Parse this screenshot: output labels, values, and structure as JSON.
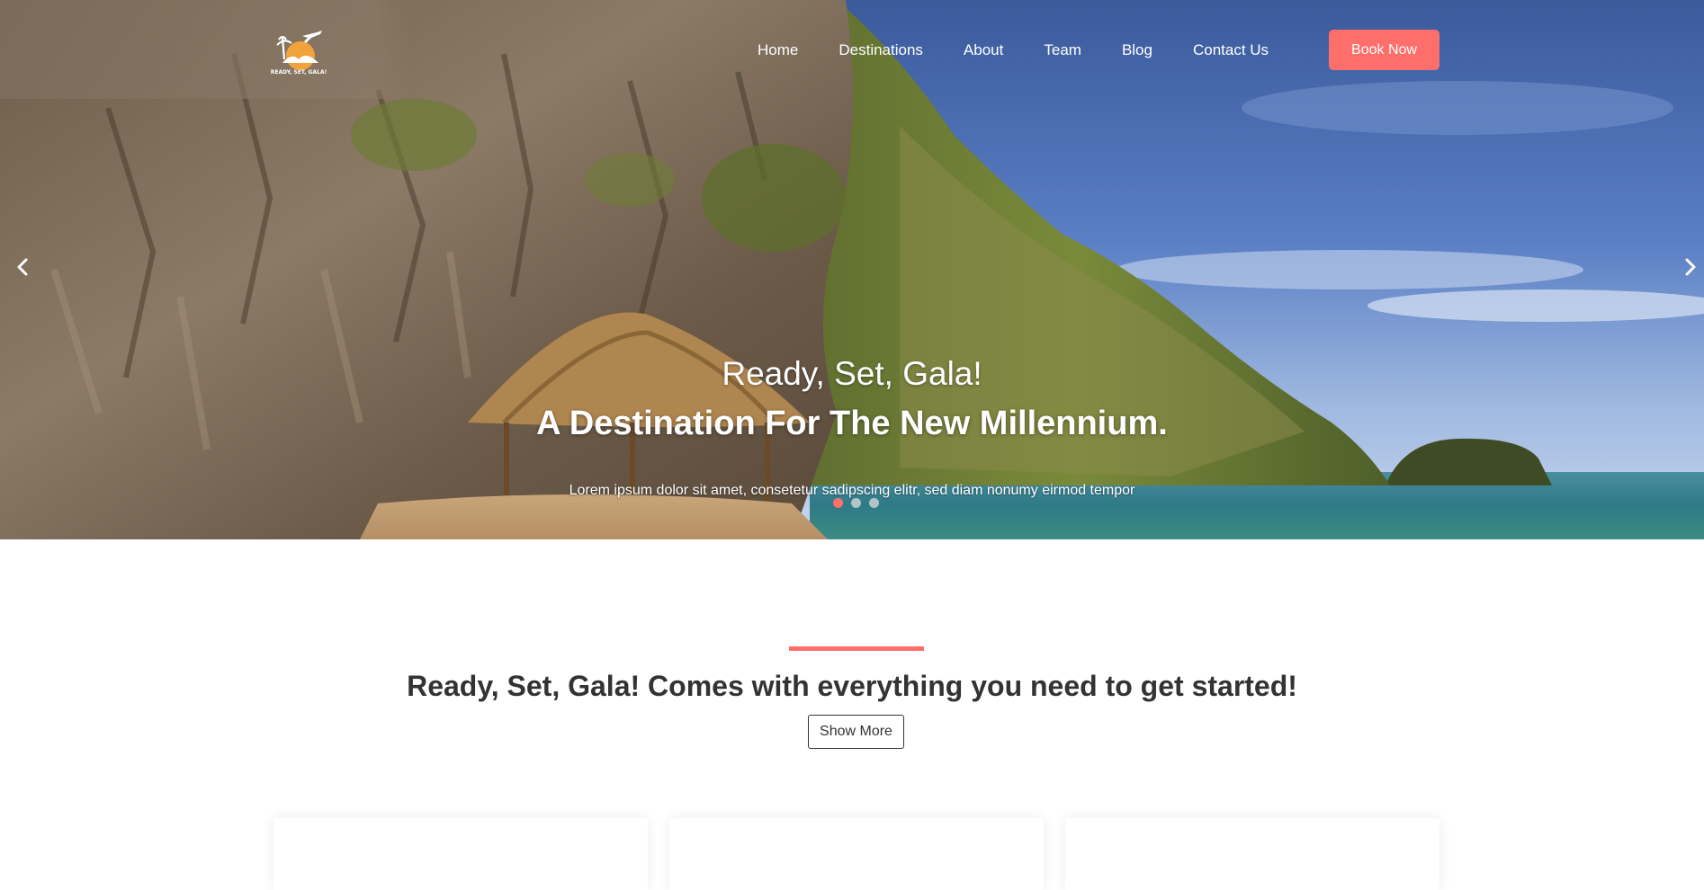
{
  "brand": {
    "logo_text": "READY, SET, GALA!",
    "accent_color": "#fe6f6c"
  },
  "nav": {
    "items": [
      {
        "label": "Home"
      },
      {
        "label": "Destinations"
      },
      {
        "label": "About"
      },
      {
        "label": "Team"
      },
      {
        "label": "Blog"
      },
      {
        "label": "Contact Us"
      }
    ],
    "book_label": "Book Now"
  },
  "hero": {
    "title": "Ready, Set, Gala!",
    "subtitle": "A Destination For The New Millennium.",
    "description": "Lorem ipsum dolor sit amet, consetetur sadipscing elitr, sed diam nonumy eirmod tempor",
    "slides_total": 3,
    "active_slide": 1,
    "prev_icon": "chevron-left-icon",
    "next_icon": "chevron-right-icon"
  },
  "intro": {
    "heading_bold": "Ready, Set, Gala!",
    "heading_rest": " Comes with everything you need to get started!",
    "button_label": "Show More"
  }
}
